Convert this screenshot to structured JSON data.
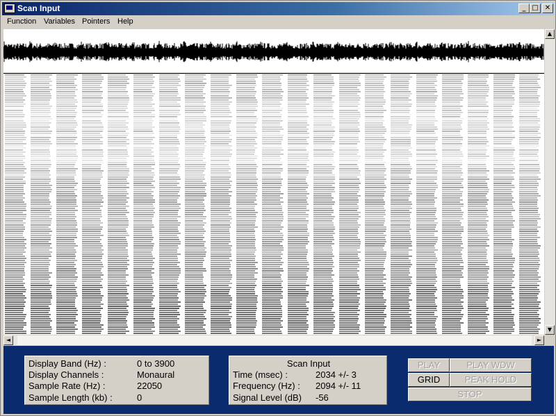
{
  "window": {
    "title": "Scan Input",
    "minimize_glyph": "_",
    "maximize_glyph": "□",
    "close_glyph": "✕"
  },
  "menu": [
    "Function",
    "Variables",
    "Pointers",
    "Help"
  ],
  "scrollbar": {
    "up": "▲",
    "down": "▼",
    "left": "◄",
    "right": "►"
  },
  "info": {
    "rows": [
      {
        "label": "Display Band (Hz) :",
        "value": "0 to 3900"
      },
      {
        "label": "Display Channels :",
        "value": "Monaural"
      },
      {
        "label": "Sample Rate (Hz) :",
        "value": "22050"
      },
      {
        "label": "Sample Length (kb) :",
        "value": "0"
      }
    ]
  },
  "scan": {
    "title": "Scan Input",
    "rows": [
      {
        "label": "Time (msec) :",
        "value": "2034 +/- 3"
      },
      {
        "label": "Frequency (Hz) :",
        "value": "2094 +/- 11"
      },
      {
        "label": "Signal Level (dB)",
        "value": "-56"
      }
    ]
  },
  "buttons": {
    "play": {
      "label": "PLAY",
      "enabled": false
    },
    "play_wdw": {
      "label": "PLAY WDW",
      "enabled": false
    },
    "grid": {
      "label": "GRID",
      "enabled": true
    },
    "peak_hold": {
      "label": "PEAK HOLD",
      "enabled": false
    },
    "stop": {
      "label": "STOP",
      "enabled": false
    }
  },
  "colors": {
    "panel_background": "#0a2b6e",
    "title_gradient_start": "#0a246a",
    "title_gradient_end": "#a6caf0"
  }
}
